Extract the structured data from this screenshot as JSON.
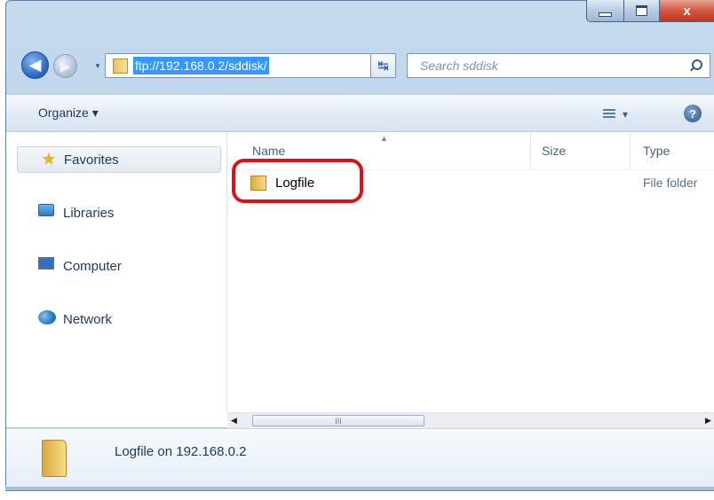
{
  "window": {
    "minimize_glyph": "min",
    "maximize_glyph": "max",
    "close_glyph": "x"
  },
  "navigation": {
    "back_glyph": "◀",
    "forward_glyph": "▶",
    "recent_glyph": "▾"
  },
  "address_bar": {
    "path": "ftp://192.168.0.2/sddisk/",
    "dropdown_glyph": "▼",
    "refresh_glyph": "↹"
  },
  "search": {
    "placeholder": "Search sddisk"
  },
  "command_bar": {
    "organize_label": "Organize ▾",
    "views_glyph": "▾",
    "help_glyph": "?"
  },
  "nav_pane": {
    "items": [
      {
        "label": "Favorites",
        "icon": "star-icon",
        "selected": true
      },
      {
        "label": "Libraries",
        "icon": "libraries-icon"
      },
      {
        "label": "Computer",
        "icon": "computer-icon"
      },
      {
        "label": "Network",
        "icon": "network-icon"
      }
    ]
  },
  "file_list": {
    "columns": {
      "name": "Name",
      "size": "Size",
      "type": "Type"
    },
    "sort_glyph": "▲",
    "rows": [
      {
        "name": "Logfile",
        "size": "",
        "type": "File folder"
      }
    ]
  },
  "scrollbar": {
    "left_glyph": "◀",
    "right_glyph": "▶",
    "thumb_glyph": "III"
  },
  "details_pane": {
    "text": "Logfile on 192.168.0.2"
  },
  "colors": {
    "highlight": "#d8121b",
    "selection": "#3399ff"
  }
}
